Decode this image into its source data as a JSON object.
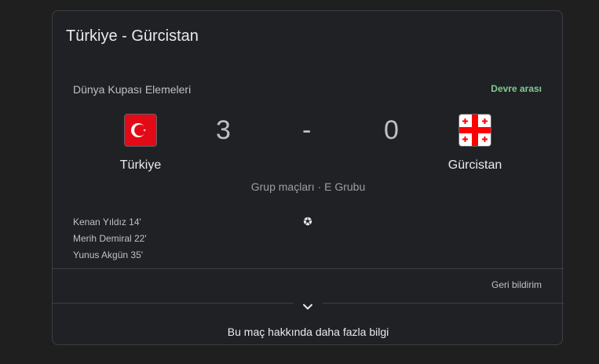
{
  "card": {
    "title": "Türkiye - Gürcistan",
    "league": "Dünya Kupası Elemeleri",
    "status": "Devre arası",
    "group": "Grup maçları · E Grubu",
    "feedback": "Geri bildirim",
    "more": "Bu maç hakkında daha fazla bilgi"
  },
  "home": {
    "name": "Türkiye",
    "score": "3",
    "flag_icon": "turkey-flag-icon"
  },
  "away": {
    "name": "Gürcistan",
    "score": "0",
    "flag_icon": "georgia-flag-icon"
  },
  "dash": "-",
  "scorers": [
    "Kenan Yıldız 14'",
    "Merih Demiral 22'",
    "Yunus Akgün 35'"
  ],
  "colors": {
    "status": "#81c995",
    "background": "#202124",
    "turkey_red": "#e30a17",
    "georgia_red": "#ff0000"
  }
}
